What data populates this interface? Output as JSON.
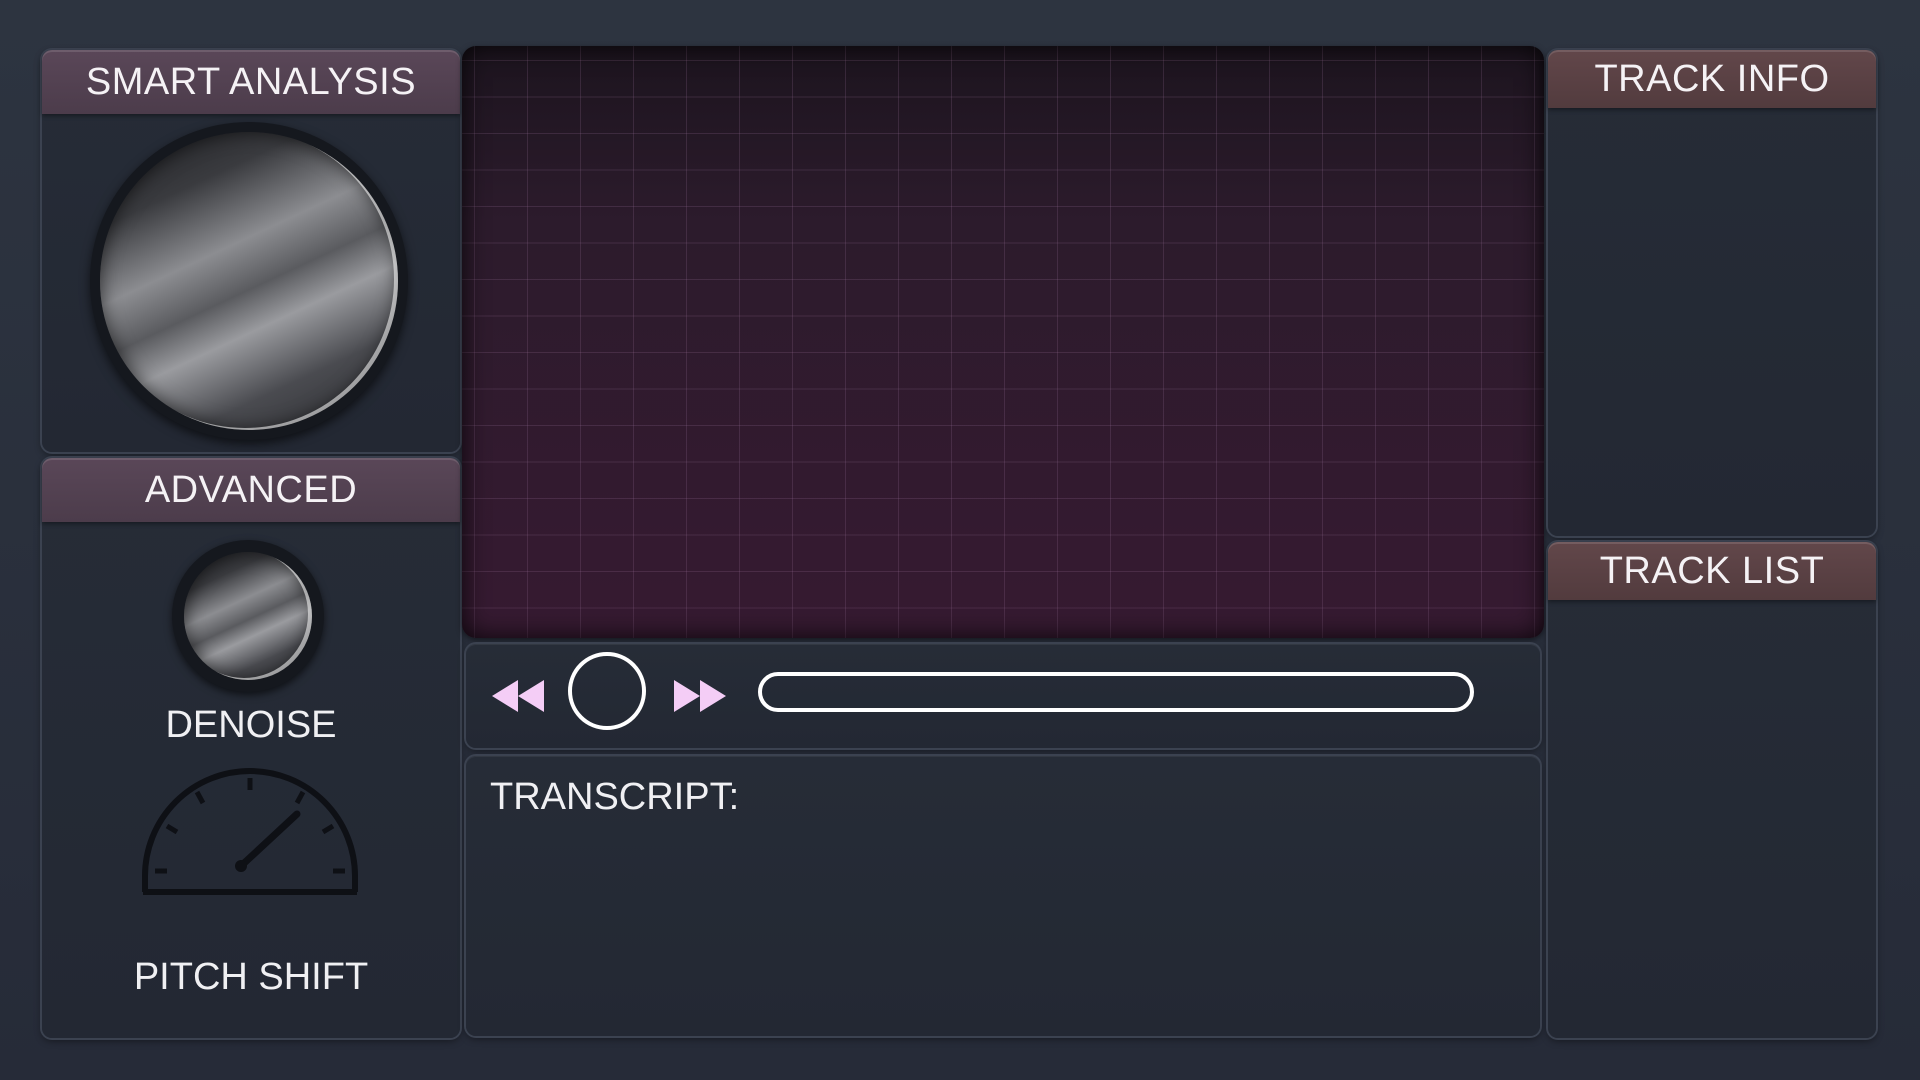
{
  "left": {
    "smart_analysis": {
      "title": "SMART ANALYSIS",
      "knob_icon": "large-knob"
    },
    "advanced": {
      "title": "ADVANCED",
      "denoise_label": "DENOISE",
      "pitch_shift_label": "PITCH SHIFT"
    }
  },
  "transport": {
    "rewind_icon": "rewind-icon",
    "play_icon": "play-circle-icon",
    "fast_forward_icon": "fast-forward-icon",
    "progress": 0.0
  },
  "transcript": {
    "label": "TRANSCRIPT:",
    "text": ""
  },
  "right": {
    "track_info_title": "TRACK INFO",
    "track_list_title": "TRACK LIST"
  },
  "colors": {
    "accent_pink": "#f4cdf6",
    "header_purple": "#4c3c4b",
    "header_brown": "#523b3e",
    "display_bg": "#2c1b2c"
  }
}
